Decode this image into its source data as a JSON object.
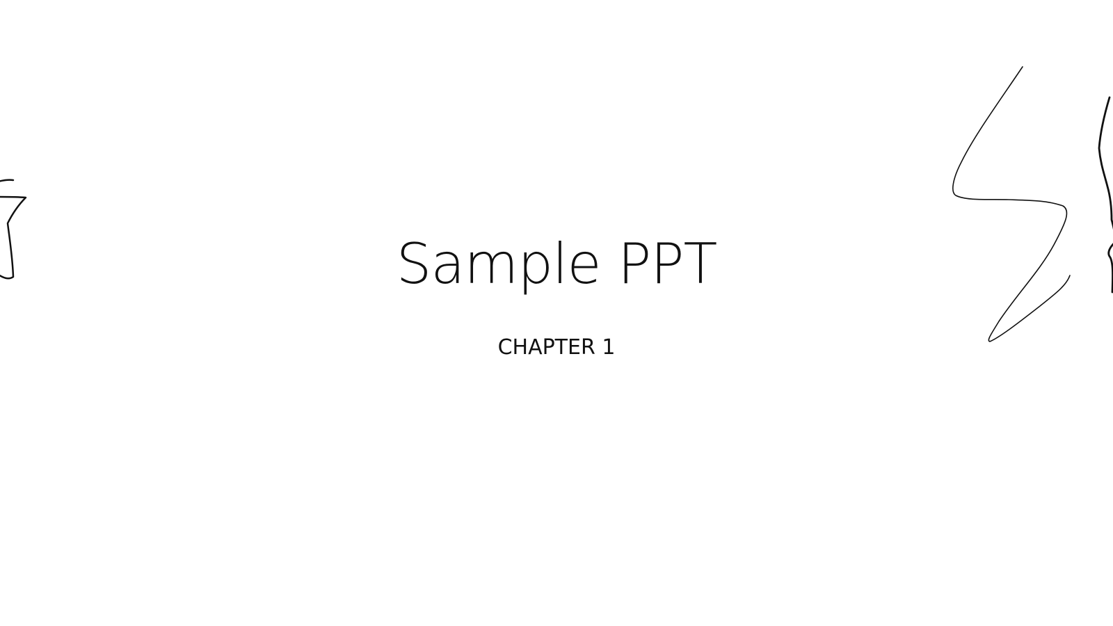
{
  "slide": {
    "title": "Sample PPT",
    "subtitle": "CHAPTER 1"
  },
  "drawings": [
    {
      "name": "star-drawing-left",
      "shape": "star",
      "color": "#111111"
    },
    {
      "name": "lightning-drawing",
      "shape": "lightning bolt",
      "color": "#111111"
    },
    {
      "name": "star-drawing-right",
      "shape": "star",
      "color": "#111111"
    }
  ]
}
